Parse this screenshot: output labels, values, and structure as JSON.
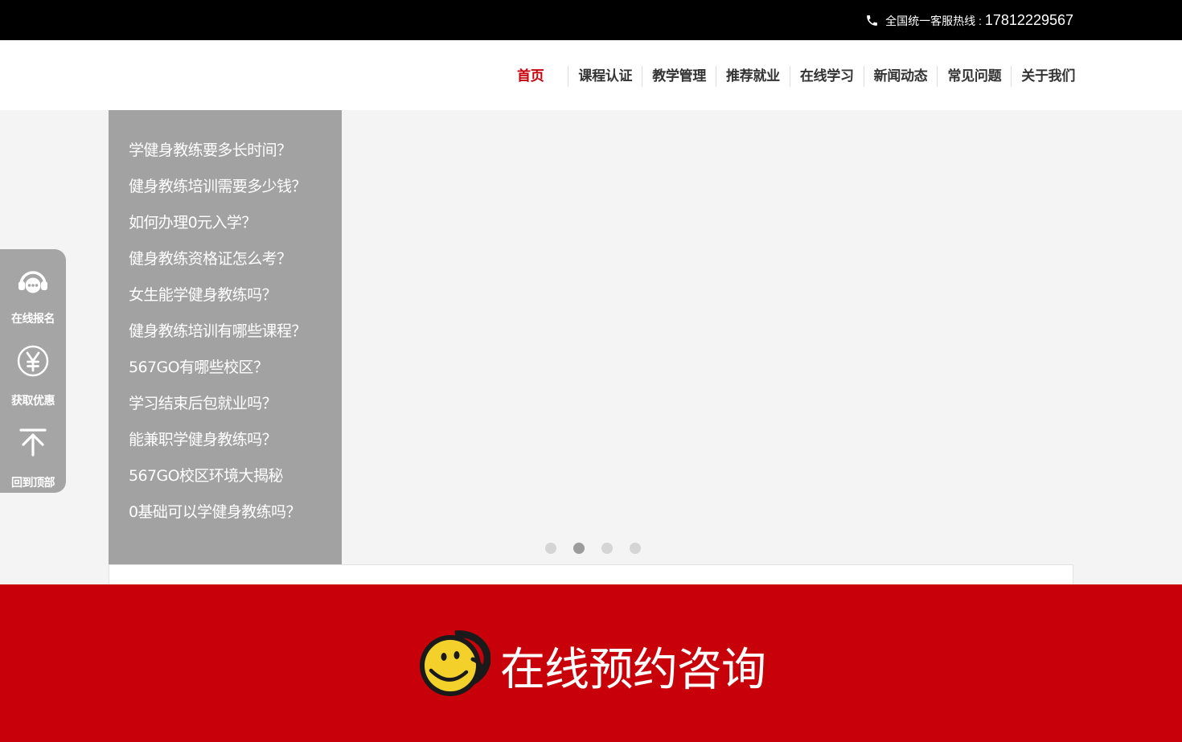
{
  "topbar": {
    "hotline_label": "全国统一客服热线 :",
    "hotline_number": "17812229567"
  },
  "nav": {
    "items": [
      "首页",
      "课程认证",
      "教学管理",
      "推荐就业",
      "在线学习",
      "新闻动态",
      "常见问题",
      "关于我们"
    ],
    "active_color": "#c8000a"
  },
  "faq": {
    "items": [
      "学健身教练要多长时间？",
      "健身教练培训需要多少钱？",
      "如何办理0元入学？",
      "健身教练资格证怎么考？",
      "女生能学健身教练吗？",
      "健身教练培训有哪些课程？",
      "567GO有哪些校区？",
      "学习结束后包就业吗？",
      "能兼职学健身教练吗？",
      "567GO校区环境大揭秘",
      "0基础可以学健身教练吗？"
    ]
  },
  "carousel": {
    "slide_count": 4,
    "active_index": 1
  },
  "sidebar": {
    "items": [
      {
        "label": "在线报名",
        "icon": "headset-icon"
      },
      {
        "label": "获取优惠",
        "icon": "yen-icon"
      },
      {
        "label": "回到顶部",
        "icon": "arrow-up-icon"
      }
    ]
  },
  "footer": {
    "consult_label": "在线预约咨询",
    "background_color": "#c8000a"
  }
}
